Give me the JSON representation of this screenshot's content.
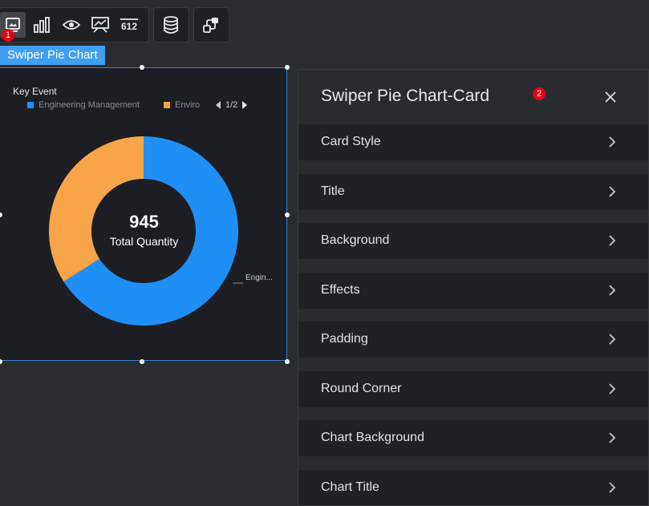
{
  "toolbar": {
    "groups": [
      {
        "buttons": [
          "image-chart-icon",
          "bar-chart-icon",
          "eye-icon",
          "monitor-chart-icon",
          "number-612-icon"
        ]
      },
      {
        "buttons": [
          "database-icon"
        ]
      },
      {
        "buttons": [
          "link-nodes-icon"
        ]
      }
    ],
    "number_icon_text": "612",
    "marker_1": "1"
  },
  "selection_label": "Swiper Pie Chart",
  "chart_data": {
    "type": "pie",
    "title": "Key Event",
    "legend": {
      "entries": [
        {
          "name": "Engineering Management",
          "color": "#1f8ff5"
        },
        {
          "name": "Enviro",
          "color": "#f7a548"
        }
      ],
      "pager": "1/2",
      "placement": "top"
    },
    "center_value": "945",
    "center_label": "Total Quantity",
    "slice_label": "Engin...",
    "slices": [
      {
        "name": "Engineering Management",
        "value": 0.66,
        "color": "#1f8ff5"
      },
      {
        "name": "Enviro",
        "value": 0.34,
        "color": "#f7a548"
      }
    ]
  },
  "panel": {
    "title": "Swiper Pie Chart-Card",
    "marker_2": "2",
    "sections": [
      {
        "label": "Card Style"
      },
      {
        "label": "Title"
      },
      {
        "label": "Background"
      },
      {
        "label": "Effects"
      },
      {
        "label": "Padding"
      },
      {
        "label": "Round Corner"
      },
      {
        "label": "Chart Background"
      },
      {
        "label": "Chart Title"
      }
    ]
  }
}
